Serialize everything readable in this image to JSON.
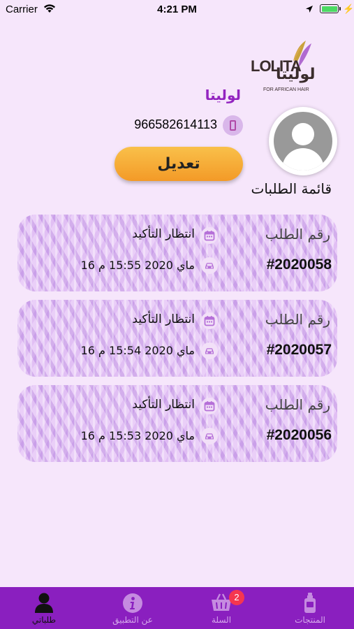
{
  "status_bar": {
    "carrier": "Carrier",
    "time": "4:21 PM"
  },
  "logo": {
    "latin": "LOLITA",
    "arabic": "لوليتا",
    "tagline": "FOR AFRICAN HAIR"
  },
  "profile": {
    "name": "لوليتا",
    "phone": "966582614113",
    "edit_label": "تعديل"
  },
  "orders_title": "قائمة الطلبات",
  "orders": [
    {
      "label": "رقم الطلب",
      "number": "#2020058",
      "status": "انتظار التأكيد",
      "date": "16 ماي 2020 15:55 م"
    },
    {
      "label": "رقم الطلب",
      "number": "#2020057",
      "status": "انتظار التأكيد",
      "date": "16 ماي 2020 15:54 م"
    },
    {
      "label": "رقم الطلب",
      "number": "#2020056",
      "status": "انتظار التأكيد",
      "date": "16 ماي 2020 15:53 م"
    }
  ],
  "tabs": [
    {
      "label": "المنتجات",
      "icon": "product-bottle-icon"
    },
    {
      "label": "السلة",
      "icon": "basket-icon",
      "badge": "2"
    },
    {
      "label": "عن التطبيق",
      "icon": "info-icon"
    },
    {
      "label": "طلباتي",
      "icon": "user-icon",
      "active": true
    }
  ],
  "colors": {
    "accent": "#8a1fbf",
    "background": "#f6e6fb",
    "edit_button": "#f5a631",
    "badge": "#f5364f"
  }
}
